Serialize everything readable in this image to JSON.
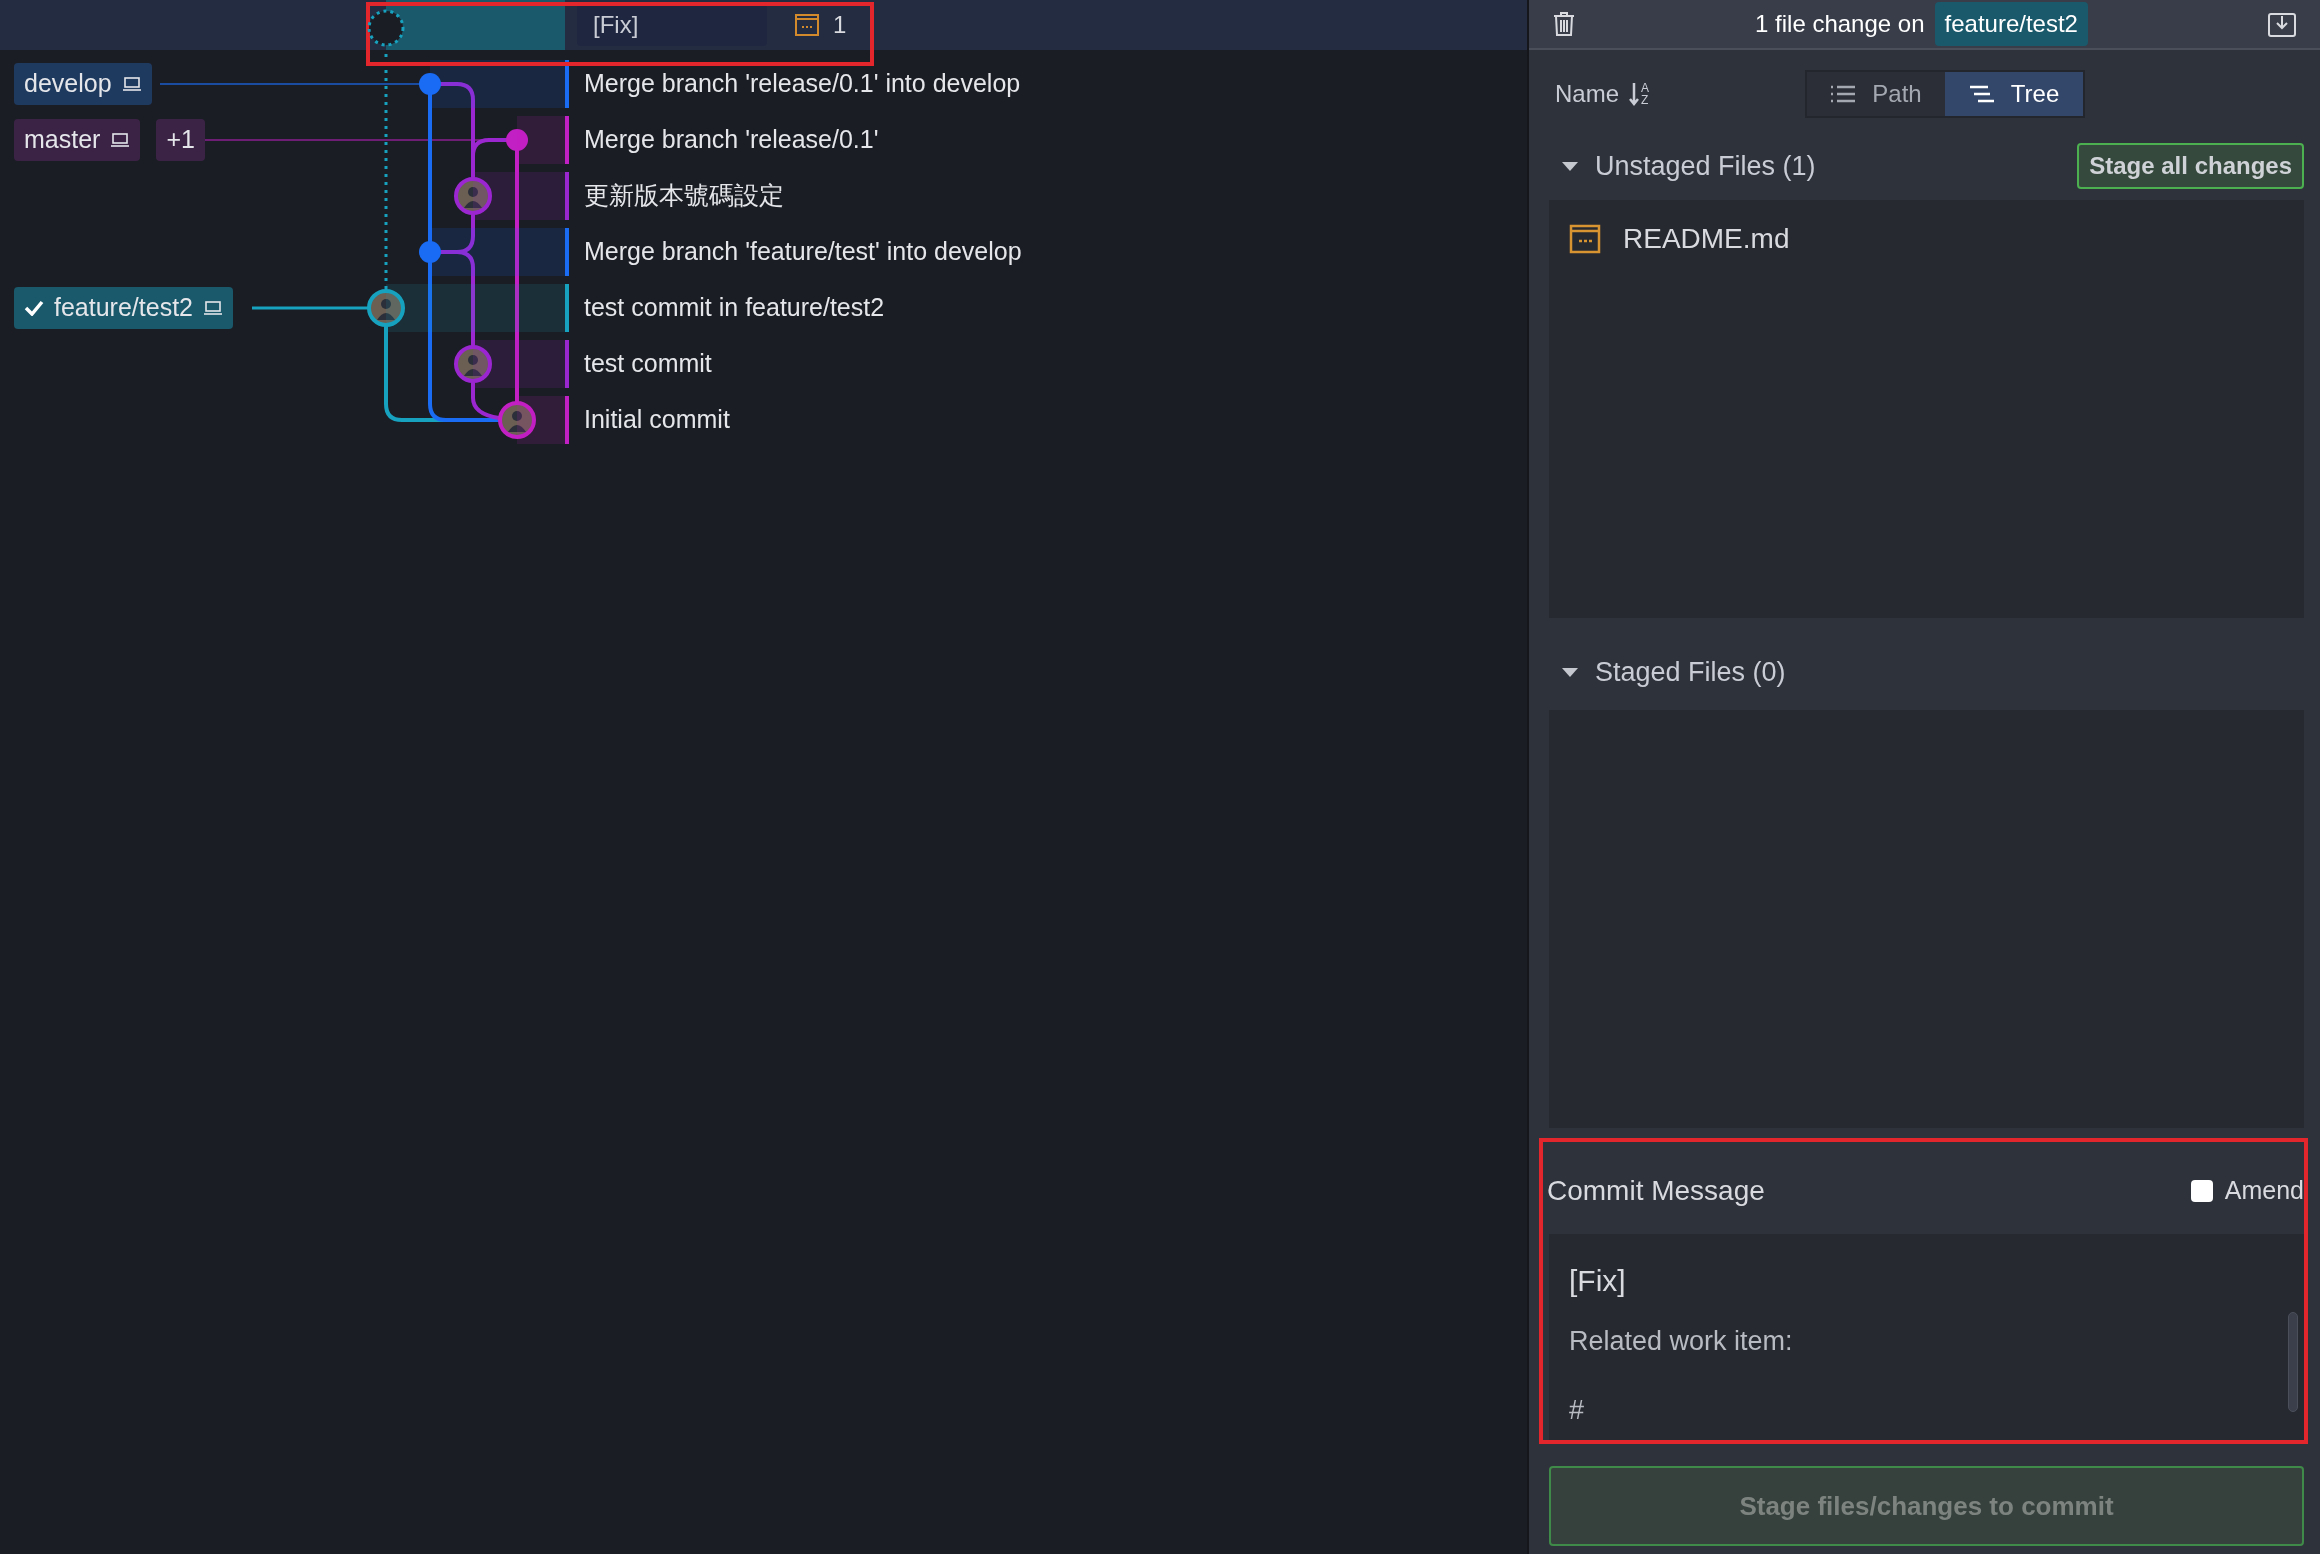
{
  "wip": {
    "message": "[Fix]",
    "file_count": "1"
  },
  "commits": [
    {
      "message": "Merge branch 'release/0.1' into develop",
      "color": "#1a6cf5",
      "kind": "dot",
      "refs": [
        {
          "label": "develop",
          "kind": "branch",
          "checked_out": false,
          "color": "#1f3a5f"
        }
      ]
    },
    {
      "message": "Merge branch 'release/0.1'",
      "color": "#c21fc4",
      "kind": "dot",
      "refs": [
        {
          "label": "master",
          "kind": "branch",
          "checked_out": false,
          "color": "#3b2346"
        },
        {
          "label": "+1",
          "kind": "count",
          "checked_out": false,
          "color": "#3b2346"
        }
      ]
    },
    {
      "message": "更新版本號碼設定",
      "color": "#9b27d1",
      "kind": "avatar"
    },
    {
      "message": "Merge branch 'feature/test' into develop",
      "color": "#1a6cf5",
      "kind": "dot"
    },
    {
      "message": "test commit in feature/test2",
      "color": "#17a2bf",
      "kind": "avatar",
      "refs": [
        {
          "label": "feature/test2",
          "kind": "branch",
          "checked_out": true,
          "color": "#19596b"
        }
      ]
    },
    {
      "message": "test commit",
      "color": "#9b27d1",
      "kind": "avatar"
    },
    {
      "message": "Initial commit",
      "color": "#c21fc4",
      "kind": "avatar"
    }
  ],
  "panel": {
    "header": {
      "text": "1 file change on",
      "branch": "feature/test2"
    },
    "sort": {
      "label": "Name",
      "letters": [
        "A",
        "Z"
      ]
    },
    "view_tabs": [
      {
        "label": "Path",
        "selected": false
      },
      {
        "label": "Tree",
        "selected": true
      }
    ],
    "unstaged": {
      "title": "Unstaged Files (1)",
      "expanded": true,
      "action": "Stage all changes",
      "files": [
        "README.md"
      ]
    },
    "staged": {
      "title": "Staged Files (0)",
      "expanded": true
    },
    "commit": {
      "title": "Commit Message",
      "amend": {
        "label": "Amend",
        "checked": false
      },
      "summary": "[Fix]",
      "description": [
        "Related work item:",
        "#"
      ]
    },
    "commit_button": {
      "label": "Stage files/changes to commit",
      "disabled": true
    }
  }
}
